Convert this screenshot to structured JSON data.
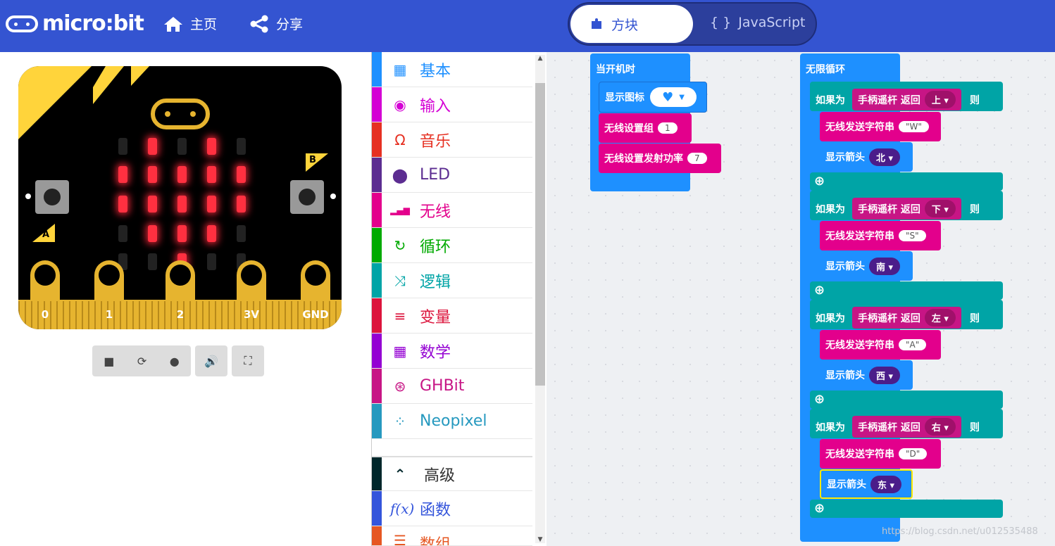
{
  "header": {
    "logo_text": "micro:bit",
    "home_label": "主页",
    "share_label": "分享",
    "tab_blocks": "方块",
    "tab_js": "JavaScript"
  },
  "simulator": {
    "led_on": [
      [
        0,
        1,
        0,
        1,
        0
      ],
      [
        1,
        1,
        1,
        1,
        1
      ],
      [
        1,
        1,
        1,
        1,
        1
      ],
      [
        0,
        1,
        1,
        1,
        0
      ],
      [
        0,
        0,
        1,
        0,
        0
      ]
    ],
    "pins": [
      "0",
      "1",
      "2",
      "3V",
      "GND"
    ],
    "button_a": "A",
    "button_b": "B",
    "controls": [
      "stop-icon",
      "restart-icon",
      "slow-icon",
      "sound-icon",
      "fullscreen-icon"
    ]
  },
  "toolbox": {
    "categories": [
      {
        "label": "基本",
        "color": "#1e90ff",
        "icon": "grid-icon"
      },
      {
        "label": "输入",
        "color": "#d400d4",
        "icon": "target-icon"
      },
      {
        "label": "音乐",
        "color": "#e63022",
        "icon": "headphones-icon"
      },
      {
        "label": "LED",
        "color": "#5c2d91",
        "icon": "toggle-icon"
      },
      {
        "label": "无线",
        "color": "#e3008c",
        "icon": "signal-icon"
      },
      {
        "label": "循环",
        "color": "#00aa00",
        "icon": "loop-icon"
      },
      {
        "label": "逻辑",
        "color": "#00a4a6",
        "icon": "shuffle-icon"
      },
      {
        "label": "变量",
        "color": "#dc143c",
        "icon": "lines-icon"
      },
      {
        "label": "数学",
        "color": "#9400d3",
        "icon": "calculator-icon"
      },
      {
        "label": "GHBit",
        "color": "#c71585",
        "icon": "gamepad-icon"
      },
      {
        "label": "Neopixel",
        "color": "#2699bf",
        "icon": "ring-icon"
      }
    ],
    "advanced": {
      "label": "高级",
      "color": "#00272b"
    },
    "functions": {
      "label": "函数",
      "color": "#3455db"
    },
    "arrays": {
      "label": "数组",
      "color": "#e65722"
    }
  },
  "workspace": {
    "on_start": {
      "title": "当开机时",
      "show_icon": "显示图标",
      "radio_group": "无线设置组",
      "group_value": "1",
      "radio_power": "无线设置发射功率",
      "power_value": "7"
    },
    "forever": {
      "title": "无限循环",
      "branches": [
        {
          "if": "如果为",
          "cond": "手柄遥杆 返回",
          "dir": "上",
          "then": "则",
          "send": "无线发送字符串",
          "str": "\"W\"",
          "show": "显示箭头",
          "arrow": "北"
        },
        {
          "if": "如果为",
          "cond": "手柄遥杆 返回",
          "dir": "下",
          "then": "则",
          "send": "无线发送字符串",
          "str": "\"S\"",
          "show": "显示箭头",
          "arrow": "南"
        },
        {
          "if": "如果为",
          "cond": "手柄遥杆 返回",
          "dir": "左",
          "then": "则",
          "send": "无线发送字符串",
          "str": "\"A\"",
          "show": "显示箭头",
          "arrow": "西"
        },
        {
          "if": "如果为",
          "cond": "手柄遥杆 返回",
          "dir": "右",
          "then": "则",
          "send": "无线发送字符串",
          "str": "\"D\"",
          "show": "显示箭头",
          "arrow": "东"
        }
      ]
    }
  },
  "watermark": "https://blog.csdn.net/u012535488"
}
